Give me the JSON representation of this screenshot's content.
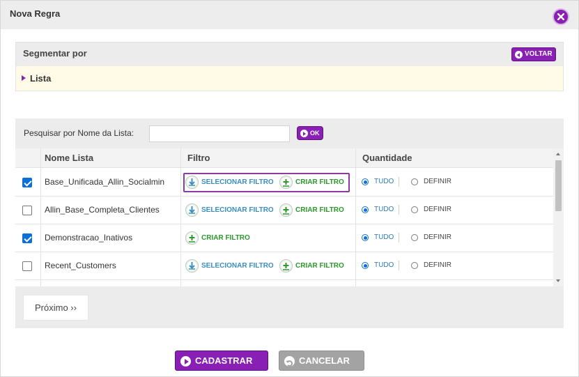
{
  "modal": {
    "title": "Nova Regra"
  },
  "segment": {
    "title": "Segmentar por",
    "back_label": "VOLTAR",
    "selected": "Lista"
  },
  "search": {
    "label": "Pesquisar por Nome da Lista:",
    "value": "",
    "ok_label": "OK"
  },
  "table": {
    "columns": [
      "Nome Lista",
      "Filtro",
      "Quantidade"
    ],
    "rows": [
      {
        "checked": true,
        "name": "Base_Unificada_Allin_Socialmin",
        "select_filter": "SELECIONAR FILTRO",
        "create_filter": "CRIAR FILTRO",
        "qty_all": "TUDO",
        "qty_define": "DEFINIR",
        "qty_selected": "TUDO"
      },
      {
        "checked": false,
        "name": "Allin_Base_Completa_Clientes",
        "select_filter": "SELECIONAR FILTRO",
        "create_filter": "CRIAR FILTRO",
        "qty_all": "TUDO",
        "qty_define": "DEFINIR",
        "qty_selected": "TUDO"
      },
      {
        "checked": true,
        "name": "Demonstracao_Inativos",
        "create_filter": "CRIAR FILTRO",
        "qty_all": "TUDO",
        "qty_define": "DEFINIR",
        "qty_selected": "TUDO"
      },
      {
        "checked": false,
        "name": "Recent_Customers",
        "select_filter": "SELECIONAR FILTRO",
        "create_filter": "CRIAR FILTRO",
        "qty_all": "TUDO",
        "qty_define": "DEFINIR",
        "qty_selected": "TUDO"
      }
    ]
  },
  "pagination": {
    "next_label": "Próximo ››"
  },
  "footer": {
    "submit_label": "CADASTRAR",
    "cancel_label": "CANCELAR"
  },
  "colors": {
    "accent": "#8a1fb5",
    "select_filter": "#3a8fc0",
    "create_filter": "#2a9a2a",
    "radio": "#0b6fd8"
  }
}
